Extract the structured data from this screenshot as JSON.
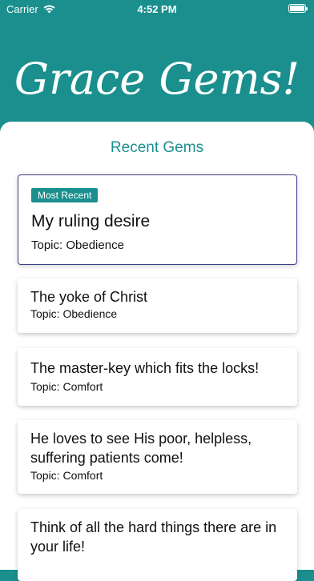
{
  "status_bar": {
    "carrier": "Carrier",
    "time": "4:52 PM"
  },
  "app_title": "Grace Gems!",
  "section_title": "Recent Gems",
  "featured": {
    "badge": "Most Recent",
    "title": "My ruling desire",
    "topic": "Topic: Obedience"
  },
  "gems": [
    {
      "title": "The yoke of Christ",
      "topic": "Topic: Obedience"
    },
    {
      "title": "The master-key which fits the locks!",
      "topic": "Topic: Comfort"
    },
    {
      "title": "He loves to see His poor, helpless, suffering patients come!",
      "topic": "Topic: Comfort"
    },
    {
      "title": "Think of all the hard things there are in your life!",
      "topic": ""
    }
  ],
  "colors": {
    "brand": "#1a8f8e",
    "featured_border": "#3b3f8a"
  }
}
